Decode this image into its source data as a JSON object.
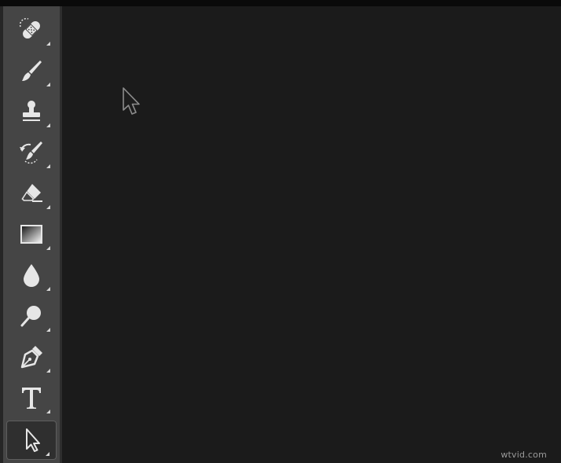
{
  "toolbar": {
    "tools": [
      {
        "name": "healing-brush-tool",
        "icon": "bandage-icon",
        "active": false,
        "has_submenu": true
      },
      {
        "name": "brush-tool",
        "icon": "brush-icon",
        "active": false,
        "has_submenu": true
      },
      {
        "name": "clone-stamp-tool",
        "icon": "stamp-icon",
        "active": false,
        "has_submenu": true
      },
      {
        "name": "history-brush-tool",
        "icon": "history-brush-icon",
        "active": false,
        "has_submenu": true
      },
      {
        "name": "eraser-tool",
        "icon": "eraser-icon",
        "active": false,
        "has_submenu": true
      },
      {
        "name": "gradient-tool",
        "icon": "gradient-icon",
        "active": false,
        "has_submenu": true
      },
      {
        "name": "blur-tool",
        "icon": "drop-icon",
        "active": false,
        "has_submenu": true
      },
      {
        "name": "dodge-tool",
        "icon": "dodge-icon",
        "active": false,
        "has_submenu": true
      },
      {
        "name": "pen-tool",
        "icon": "pen-nib-icon",
        "active": false,
        "has_submenu": true
      },
      {
        "name": "type-tool",
        "icon": "type-icon",
        "active": false,
        "has_submenu": true
      },
      {
        "name": "path-selection-tool",
        "icon": "arrow-cursor-icon",
        "active": true,
        "has_submenu": true
      }
    ]
  },
  "colors": {
    "canvas": "#1b1b1b",
    "toolbar": "#454545",
    "icon": "#e6e6e6",
    "active_tool_bg": "#2f2f2f"
  },
  "watermark": "wtvid.com"
}
